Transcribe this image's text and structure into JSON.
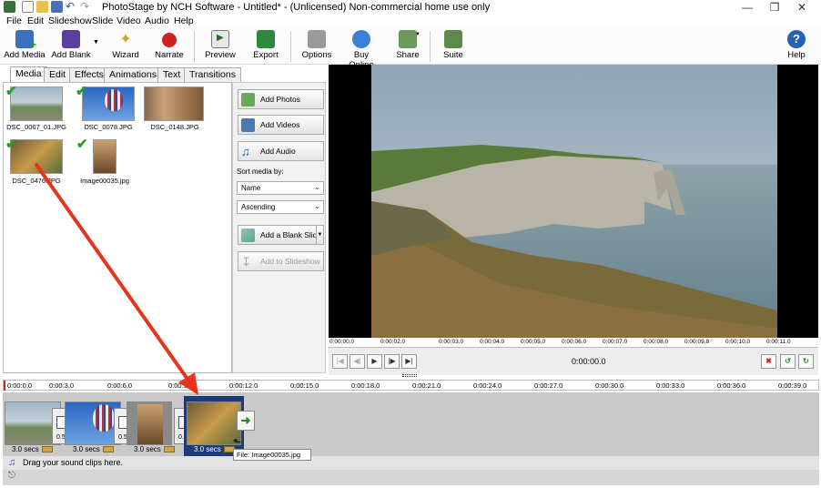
{
  "window": {
    "title": "PhotoStage by NCH Software - Untitled* - (Unlicensed) Non-commercial home use only",
    "minimize": "—",
    "maximize": "❐",
    "close": "✕"
  },
  "menu": [
    "File",
    "Edit",
    "Slideshow",
    "Slide",
    "Video",
    "Audio",
    "Help"
  ],
  "toolbar": {
    "add_media": "Add Media",
    "add_blank": "Add Blank",
    "wizard": "Wizard",
    "narrate": "Narrate",
    "preview": "Preview",
    "export": "Export",
    "options": "Options",
    "buy_online": "Buy Online",
    "share": "Share",
    "suite": "Suite",
    "help": "Help"
  },
  "tabs": [
    "Media",
    "Edit",
    "Effects",
    "Animations",
    "Text",
    "Transitions"
  ],
  "media": {
    "items": [
      {
        "name": "DSC_0067_01.JPG",
        "checked": true
      },
      {
        "name": "DSC_0078.JPG",
        "checked": true
      },
      {
        "name": "DSC_0148.JPG",
        "checked": false
      },
      {
        "name": "DSC_0476.JPG",
        "checked": true
      },
      {
        "name": "Image00035.jpg",
        "checked": true
      }
    ]
  },
  "side": {
    "add_photos": "Add Photos",
    "add_videos": "Add Videos",
    "add_audio": "Add Audio",
    "sort_label": "Sort media by:",
    "sort_by": "Name",
    "order": "Ascending",
    "add_blank_slide": "Add a Blank Slide",
    "add_to_slideshow": "Add to Slideshow"
  },
  "preview": {
    "ruler": [
      "0:00:00.0",
      "0:00:02.0",
      "0:00:03.0",
      "0:00:04.0",
      "0:00:05.0",
      "0:00:06.0",
      "0:00:07.0",
      "0:00:08.0",
      "0:00:09.8",
      "0:00:10.0",
      "0:00:11.0"
    ],
    "time": "0:00:00.0"
  },
  "timeline": {
    "ruler": [
      "0:00:0.0",
      "0:00:3.0",
      "0:00:6.0",
      "0:00:9.0",
      "0:00:12.0",
      "0:00:15.0",
      "0:00:18.0",
      "0:00:21.0",
      "0:00:24.0",
      "0:00:27.0",
      "0:00:30.0",
      "0:00:33.0",
      "0:00:36.0",
      "0:00:39.0"
    ],
    "clips": [
      {
        "duration": "3.0 secs"
      },
      {
        "duration": "3.0 secs"
      },
      {
        "duration": "3.0 secs"
      },
      {
        "duration": "3.0 secs"
      }
    ],
    "transitions": [
      "0.5",
      "0.5",
      "0.5"
    ],
    "sound_hint": "Drag your sound clips here.",
    "tooltip": "File: Image00035.jpg"
  },
  "colors": {
    "arrow": "#e8341c",
    "check": "#24a024",
    "selection": "#1f3a78"
  }
}
